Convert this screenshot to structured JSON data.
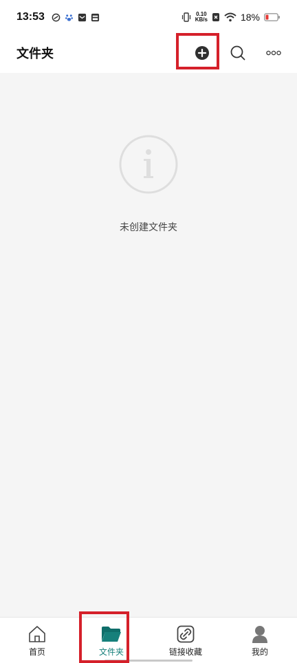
{
  "status_bar": {
    "time": "13:53",
    "net_speed_value": "0.10",
    "net_speed_unit": "KB/s",
    "battery": "18%"
  },
  "header": {
    "title": "文件夹"
  },
  "empty_state": {
    "message": "未创建文件夹"
  },
  "bottom_nav": {
    "tabs": [
      {
        "label": "首页",
        "icon": "home-icon"
      },
      {
        "label": "文件夹",
        "icon": "folder-icon",
        "active": true
      },
      {
        "label": "链接收藏",
        "icon": "link-icon"
      },
      {
        "label": "我的",
        "icon": "user-icon"
      }
    ]
  },
  "colors": {
    "accent": "#16807b",
    "highlight": "#d5202a",
    "background": "#f5f5f5"
  }
}
